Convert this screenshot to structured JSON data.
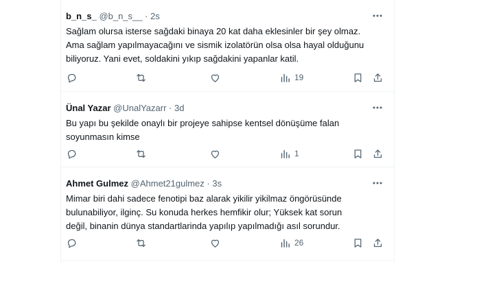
{
  "tweets": [
    {
      "name": "b_n_s_",
      "handle": "@b_n_s__",
      "dot": "·",
      "time": "2s",
      "text": "Sağlam olursa isterse sağdaki binaya 20 kat daha eklesinler bir şey olmaz.\nAma sağlam yapılmayacağını ve sismik izolatörün olsa olsa hayal olduğunu\nbiliyoruz. Yani evet, soldakini yıkıp sağdakini yapanlar katil.",
      "views": "19"
    },
    {
      "name": "Ünal Yazar",
      "handle": "@UnalYazarr",
      "dot": "·",
      "time": "3d",
      "text": "Bu yapı bu şekilde onaylı bir projeye sahipse kentsel dönüşüme falan\nsoyunmasın kimse",
      "views": "1"
    },
    {
      "name": "Ahmet Gulmez",
      "handle": "@Ahmet21gulmez",
      "dot": "·",
      "time": "3s",
      "text": "Mimar biri dahi sadece fenotipi baz alarak yikilir yikilmaz öngörüsünde\nbulunabiliyor, ilginç. Su konuda herkes hemfikir olur; Yüksek kat sorun\ndeğil, binanin dünya standartlarinda yapılıp yapılmadığı asıl sorundur.",
      "views": "26"
    }
  ],
  "icons": {
    "more": "more-dots-icon",
    "reply": "reply-icon",
    "retweet": "retweet-icon",
    "like": "heart-icon",
    "views": "views-icon",
    "bookmark": "bookmark-icon",
    "share": "share-icon"
  },
  "colors": {
    "text": "#0f1419",
    "secondary": "#536471",
    "border": "#eff3f4"
  }
}
